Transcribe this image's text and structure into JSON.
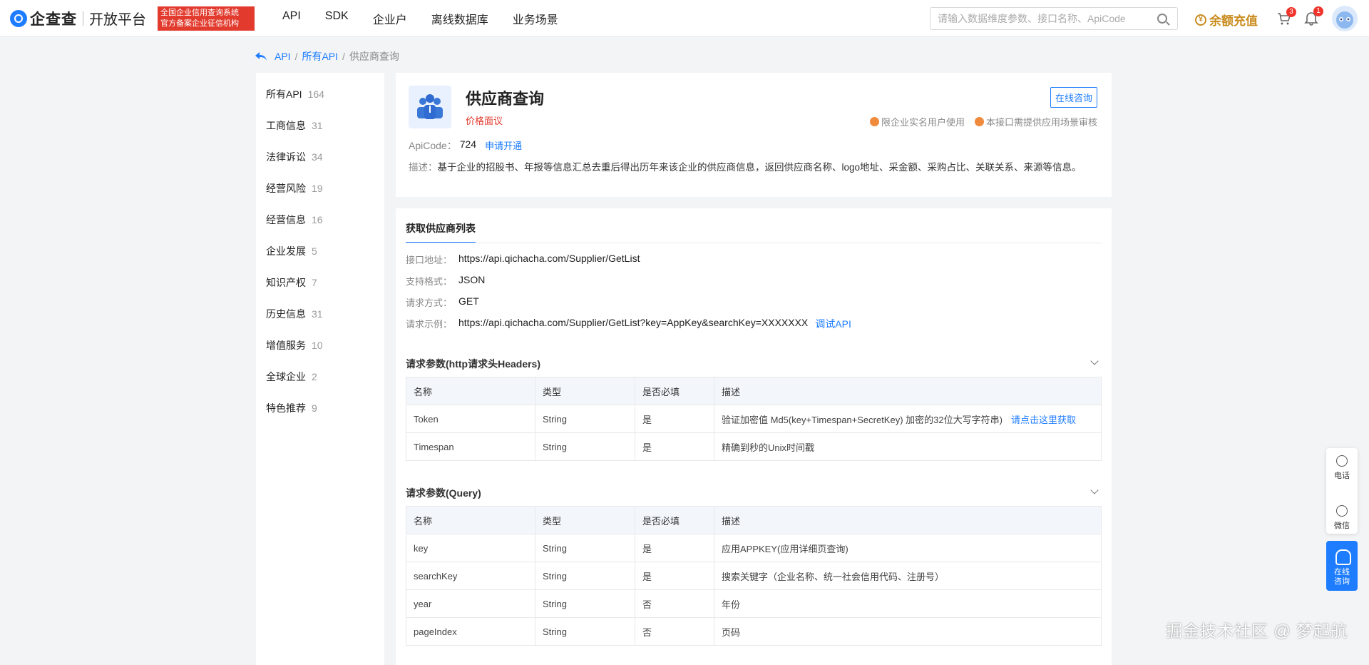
{
  "header": {
    "logo_name": "企查查",
    "logo_sub": "开放平台",
    "badge_line1": "全国企业信用查询系统",
    "badge_line2": "官方备案企业征信机构",
    "nav": [
      "API",
      "SDK",
      "企业户",
      "离线数据库",
      "业务场景"
    ],
    "search_placeholder": "请输入数据维度参数、接口名称、ApiCode",
    "recharge": "余额充值",
    "recharge_icon": "¥",
    "cart_count": "3",
    "bell_count": "1"
  },
  "breadcrumb": {
    "root": "API",
    "sep": "/",
    "mid": "所有API",
    "current": "供应商查询"
  },
  "sidebar": [
    {
      "label": "所有API",
      "count": "164"
    },
    {
      "label": "工商信息",
      "count": "31"
    },
    {
      "label": "法律诉讼",
      "count": "34"
    },
    {
      "label": "经营风险",
      "count": "19"
    },
    {
      "label": "经营信息",
      "count": "16"
    },
    {
      "label": "企业发展",
      "count": "5"
    },
    {
      "label": "知识产权",
      "count": "7"
    },
    {
      "label": "历史信息",
      "count": "31"
    },
    {
      "label": "增值服务",
      "count": "10"
    },
    {
      "label": "全球企业",
      "count": "2"
    },
    {
      "label": "特色推荐",
      "count": "9"
    }
  ],
  "api": {
    "title": "供应商查询",
    "price": "价格面议",
    "consult": "在线咨询",
    "tag1": "限企业实名用户使用",
    "tag2": "本接口需提供应用场景审核",
    "apicode_label": "ApiCode：",
    "apicode": "724",
    "apply": "申请开通",
    "desc_label": "描述：",
    "desc": "基于企业的招股书、年报等信息汇总去重后得出历年来该企业的供应商信息，返回供应商名称、logo地址、采金额、采购占比、关联关系、来源等信息。"
  },
  "detail": {
    "tab": "获取供应商列表",
    "url_label": "接口地址：",
    "url": "https://api.qichacha.com/Supplier/GetList",
    "format_label": "支持格式：",
    "format": "JSON",
    "method_label": "请求方式：",
    "method": "GET",
    "example_label": "请求示例：",
    "example": "https://api.qichacha.com/Supplier/GetList?key=AppKey&searchKey=XXXXXXX",
    "debug": "调试API",
    "headers_title": "请求参数(http请求头Headers)",
    "query_title": "请求参数(Query)",
    "cols": [
      "名称",
      "类型",
      "是否必填",
      "描述"
    ],
    "headers_rows": [
      {
        "name": "Token",
        "type": "String",
        "req": "是",
        "desc": "验证加密值 Md5(key+Timespan+SecretKey) 加密的32位大写字符串)",
        "link": "请点击这里获取"
      },
      {
        "name": "Timespan",
        "type": "String",
        "req": "是",
        "desc": "精确到秒的Unix时间戳",
        "link": ""
      }
    ],
    "query_rows": [
      {
        "name": "key",
        "type": "String",
        "req": "是",
        "desc": "应用APPKEY(应用详细页查询)"
      },
      {
        "name": "searchKey",
        "type": "String",
        "req": "是",
        "desc": "搜索关键字（企业名称、统一社会信用代码、注册号）"
      },
      {
        "name": "year",
        "type": "String",
        "req": "否",
        "desc": "年份"
      },
      {
        "name": "pageIndex",
        "type": "String",
        "req": "否",
        "desc": "页码"
      }
    ]
  },
  "float": {
    "phone": "电话",
    "wechat": "微信",
    "consult_l1": "在线",
    "consult_l2": "咨询"
  },
  "watermark": "掘金技术社区 @ 梦起航"
}
